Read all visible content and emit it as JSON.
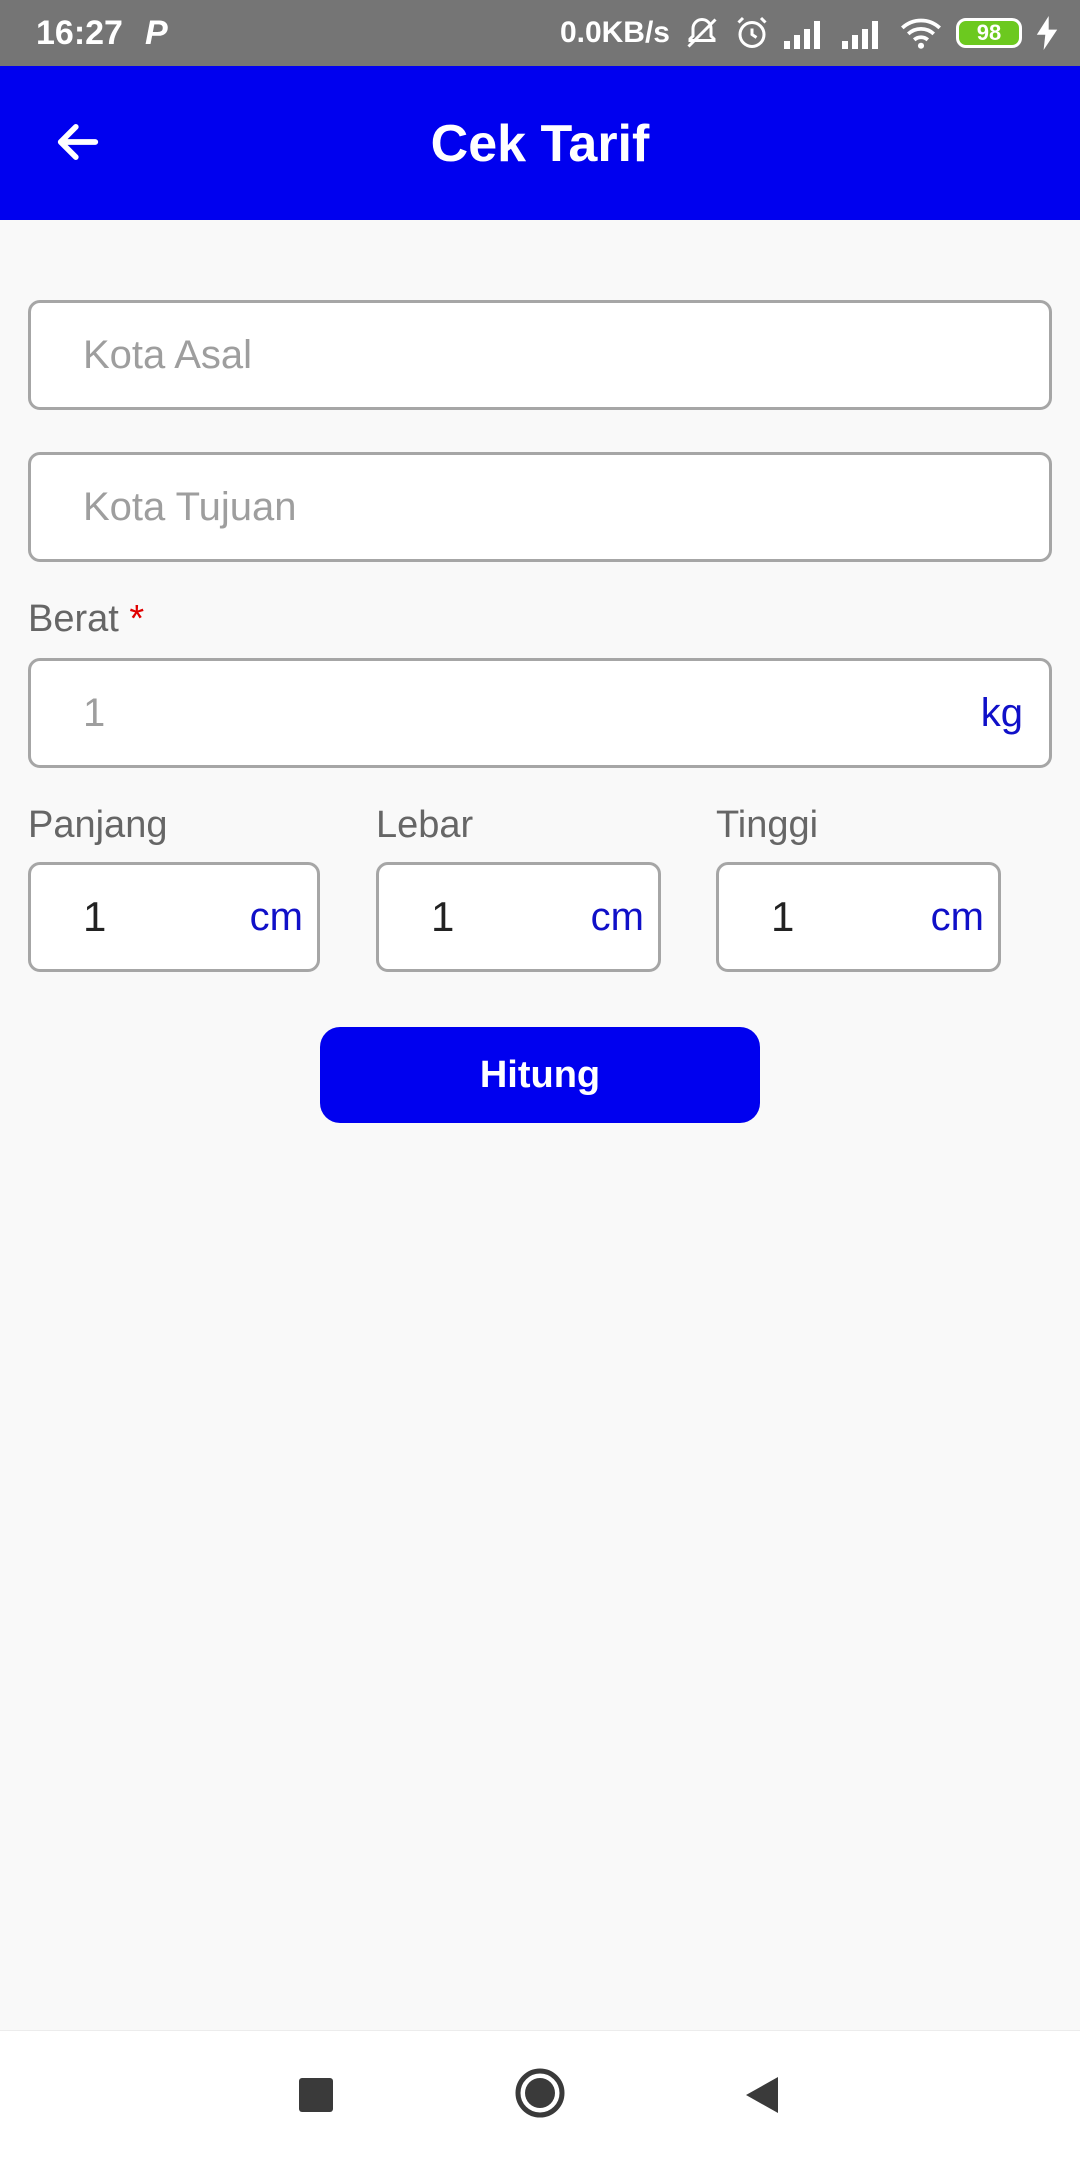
{
  "status_bar": {
    "time": "16:27",
    "app_icon": "P",
    "network_speed": "0.0KB/s",
    "battery_level": "98",
    "icons": [
      "mute-icon",
      "alarm-icon",
      "signal-icon",
      "signal-icon",
      "wifi-icon",
      "battery-icon",
      "charging-icon"
    ]
  },
  "app_bar": {
    "title": "Cek Tarif",
    "back_icon": "arrow-left-icon"
  },
  "form": {
    "origin": {
      "placeholder": "Kota Asal",
      "value": ""
    },
    "destination": {
      "placeholder": "Kota Tujuan",
      "value": ""
    },
    "weight": {
      "label": "Berat",
      "required_mark": "*",
      "placeholder": "1",
      "value": "",
      "unit": "kg"
    },
    "length": {
      "label": "Panjang",
      "value": "1",
      "unit": "cm"
    },
    "width": {
      "label": "Lebar",
      "value": "1",
      "unit": "cm"
    },
    "height": {
      "label": "Tinggi",
      "value": "1",
      "unit": "cm"
    },
    "submit_label": "Hitung"
  },
  "nav_bar": {
    "buttons": [
      "recent-apps-icon",
      "home-icon",
      "back-icon"
    ]
  },
  "colors": {
    "primary": "#0000ef",
    "status_bar": "#757575",
    "unit_text": "#1010c8",
    "required": "#e00000",
    "background": "#f9f9f9"
  }
}
